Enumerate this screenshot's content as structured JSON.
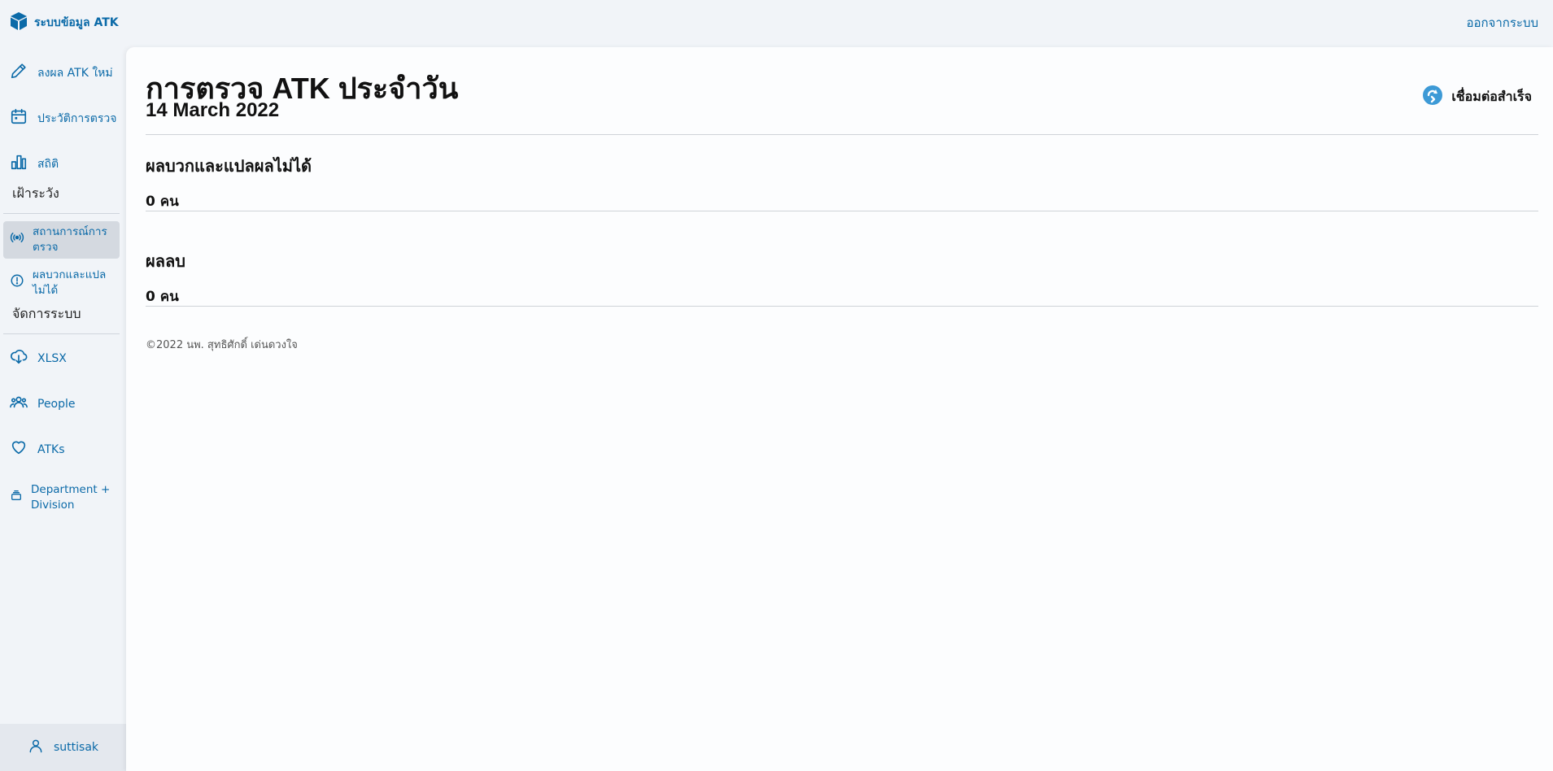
{
  "app": {
    "title": "ระบบข้อมูล ATK",
    "logout_label": "ออกจากระบบ",
    "accent_color": "#0b6aa8"
  },
  "sidebar": {
    "items": [
      {
        "label": "ลงผล ATK ใหม่",
        "icon": "pencil-icon"
      },
      {
        "label": "ประวัติการตรวจ",
        "icon": "calendar-icon"
      },
      {
        "label": "สถิติ",
        "icon": "bar-chart-icon"
      }
    ],
    "section_watch": "เฝ้าระวัง",
    "watch_items": [
      {
        "label": "สถานการณ์การตรวจ",
        "icon": "broadcast-icon",
        "active": true
      },
      {
        "label": "ผลบวกและแปลไม่ได้",
        "icon": "alert-circle-icon"
      }
    ],
    "section_admin": "จัดการระบบ",
    "admin_items": [
      {
        "label": "XLSX",
        "icon": "cloud-download-icon"
      },
      {
        "label": "People",
        "icon": "users-icon"
      },
      {
        "label": "ATKs",
        "icon": "heart-icon"
      },
      {
        "label": "Department + Division",
        "icon": "stack-icon"
      }
    ],
    "user": "suttisak"
  },
  "main": {
    "title": "การตรวจ ATK ประจำวัน",
    "date": "14 March 2022",
    "connection_status": "เชื่อมต่อสำเร็จ",
    "sections": [
      {
        "heading": "ผลบวกและแปลผลไม่ได้",
        "count": "0 คน"
      },
      {
        "heading": "ผลลบ",
        "count": "0 คน"
      }
    ],
    "footer": "©2022 นพ. สุทธิศักดิ์ เด่นดวงใจ"
  }
}
